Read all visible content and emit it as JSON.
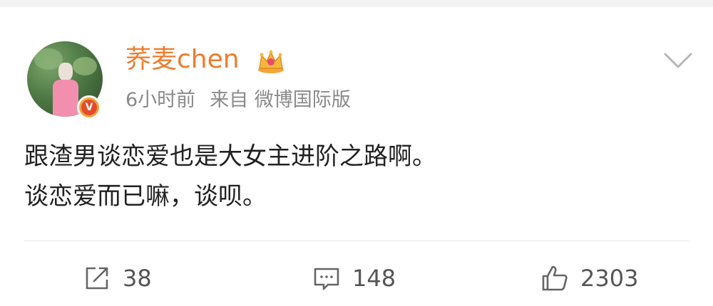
{
  "post": {
    "username": "荞麦chen",
    "time": "6小时前",
    "source": "来自 微博国际版",
    "lines": [
      "跟渣男谈恋爱也是大女主进阶之路啊。",
      "谈恋爱而已嘛，谈呗。"
    ],
    "verified_mark": "V"
  },
  "actions": {
    "repost_count": "38",
    "comment_count": "148",
    "like_count": "2303"
  },
  "icons": {
    "crown": "crown-badge-icon",
    "chevron": "chevron-down-icon",
    "repost": "share-icon",
    "comment": "comment-icon",
    "like": "thumbs-up-icon"
  },
  "colors": {
    "username": "#f07b2b",
    "meta": "#8a8a8a",
    "verified": "#e34b2b"
  }
}
